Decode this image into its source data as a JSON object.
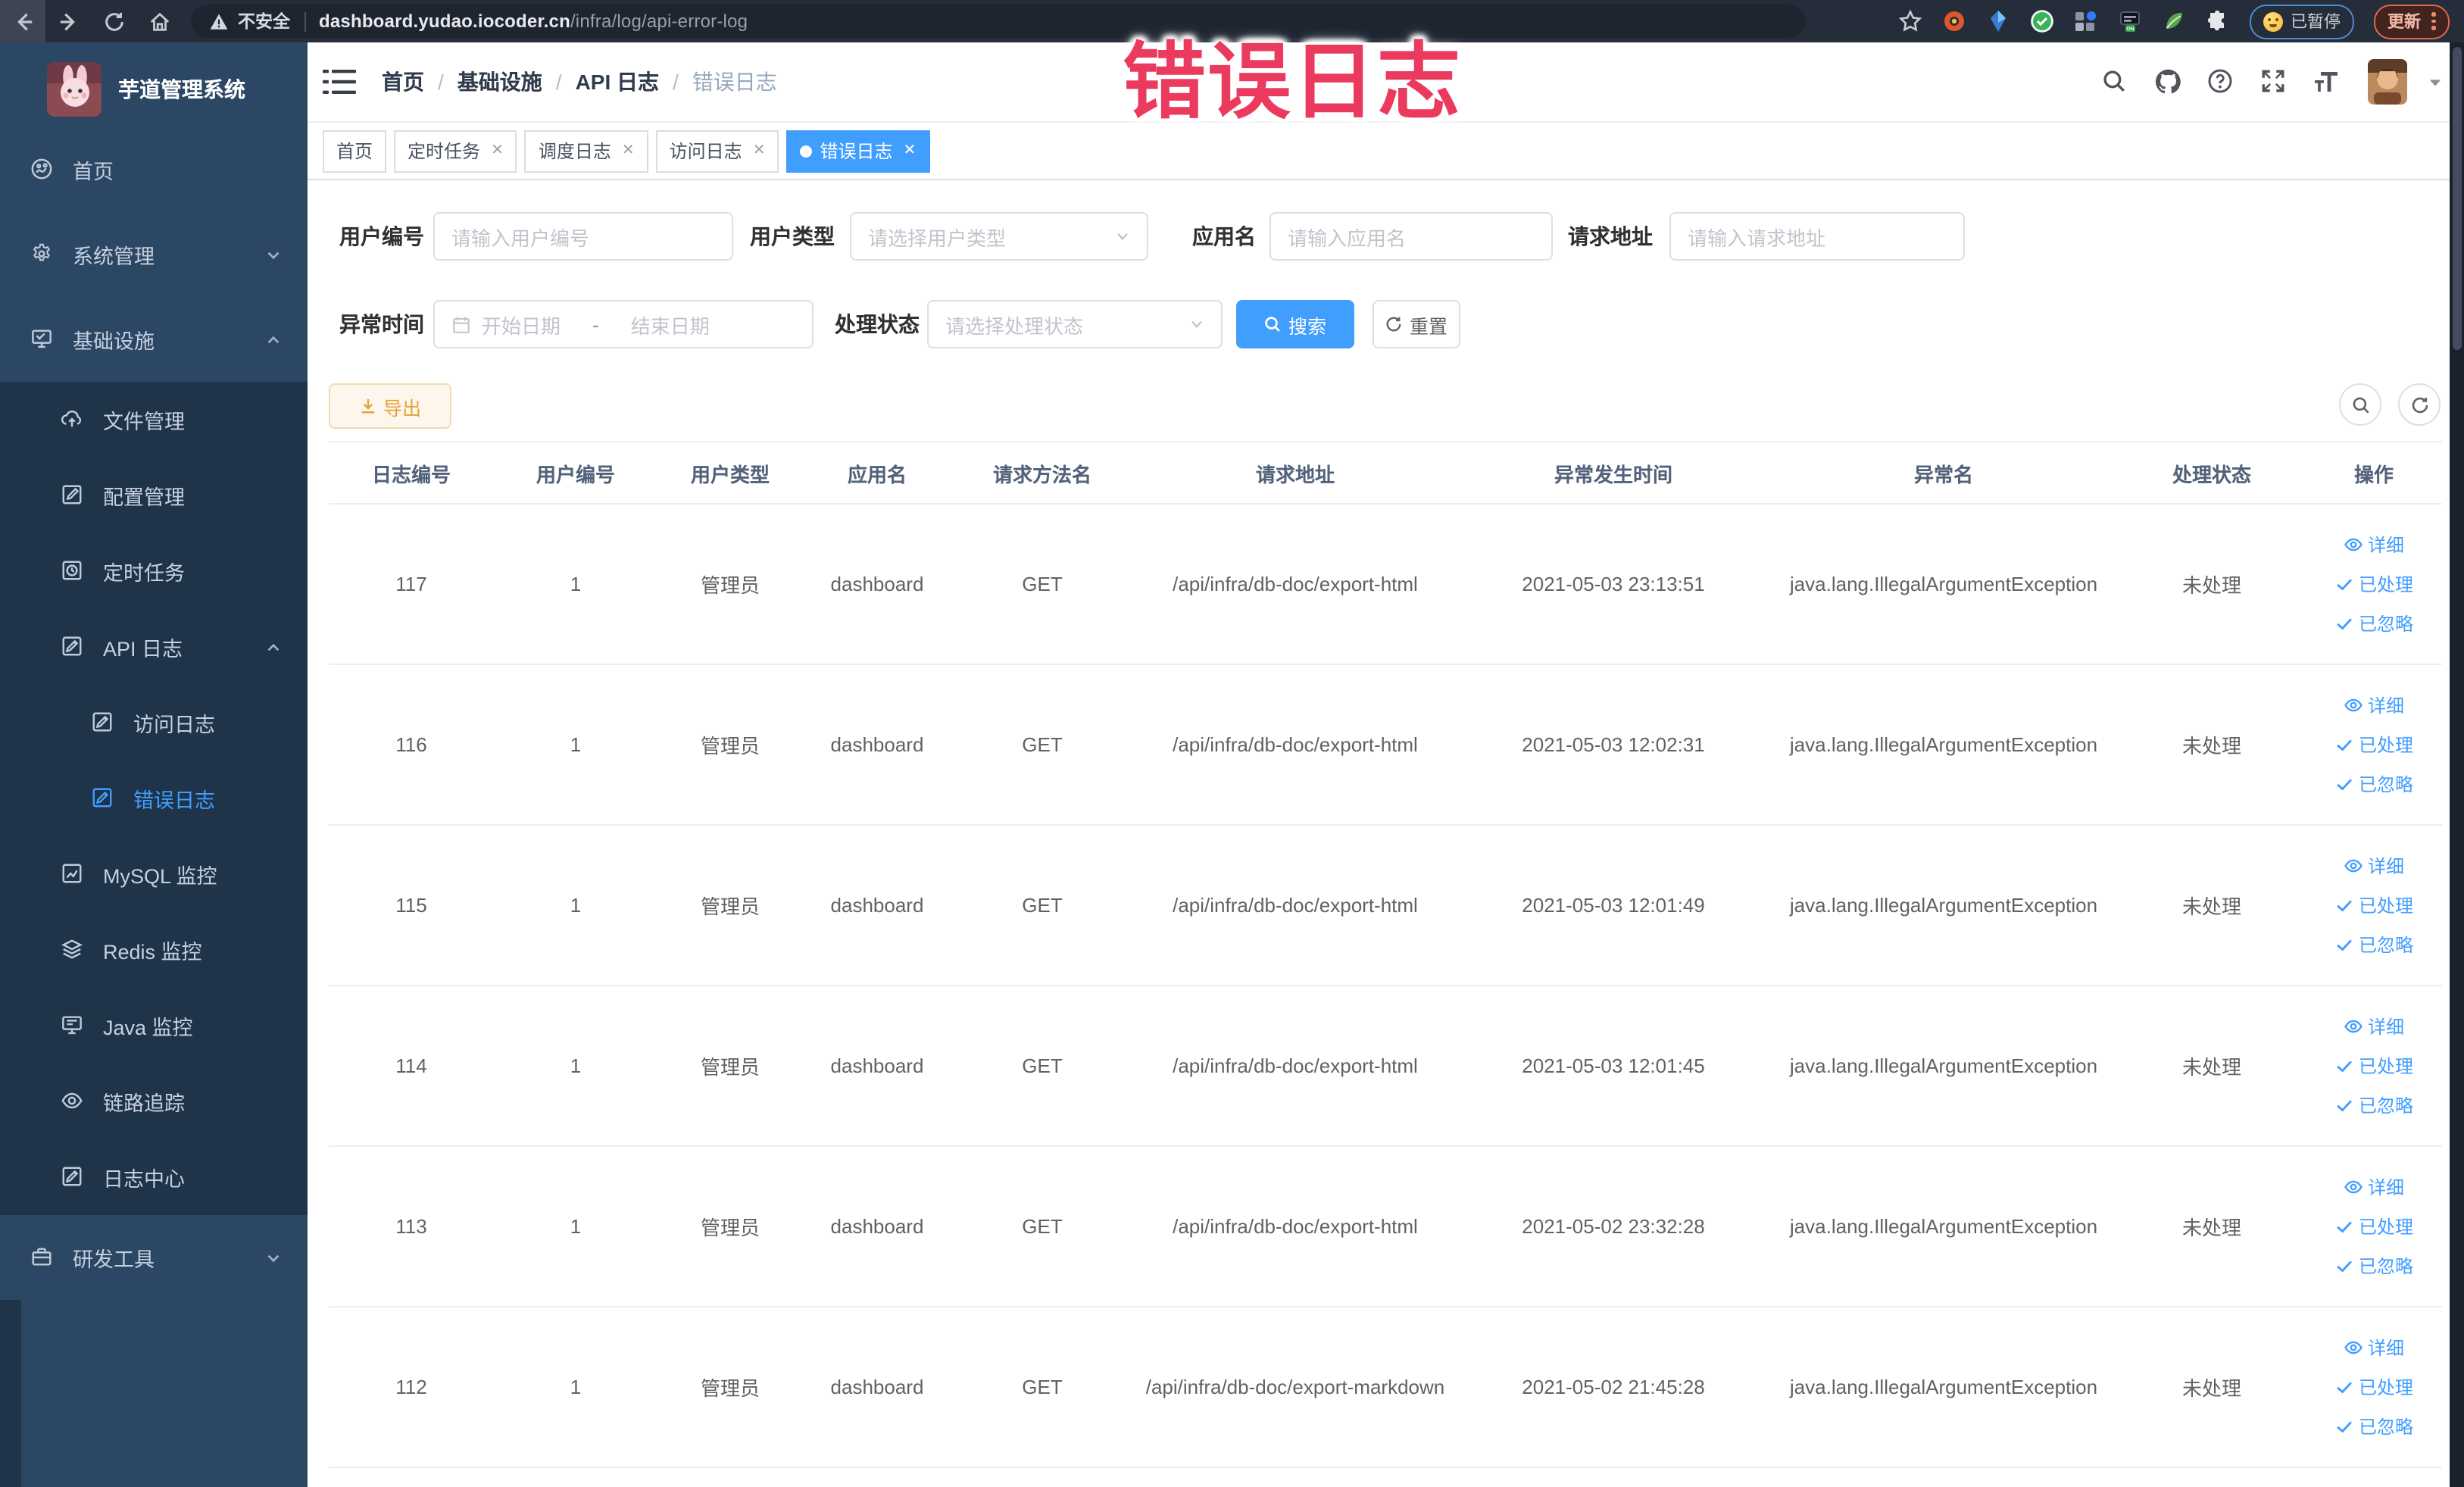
{
  "browser": {
    "security_label": "不安全",
    "url_host": "dashboard.yudao.iocoder.cn",
    "url_path": "/infra/log/api-error-log",
    "paused_label": "已暂停",
    "update_label": "更新",
    "nav_icons": [
      "back-icon",
      "forward-icon",
      "reload-icon",
      "home-icon"
    ],
    "extension_icons": [
      "orange-ring-extension-icon",
      "blue-drop-extension-icon",
      "green-check-extension-icon",
      "grid-extension-icon",
      "switch-on-extension-icon",
      "leaf-extension-icon",
      "puzzle-extensions-icon"
    ]
  },
  "annotation": {
    "text": "错误日志",
    "color": "#ea3b5f"
  },
  "sidebar": {
    "title": "芋道管理系统",
    "items": [
      {
        "label": "首页",
        "icon": "home",
        "level": 0
      },
      {
        "label": "系统管理",
        "icon": "gear",
        "level": 0,
        "chevron": "down"
      },
      {
        "label": "基础设施",
        "icon": "infra",
        "level": 0,
        "chevron": "up"
      },
      {
        "label": "文件管理",
        "icon": "cloud-upload",
        "level": 1,
        "dark": true
      },
      {
        "label": "配置管理",
        "icon": "edit-square",
        "level": 1,
        "dark": true
      },
      {
        "label": "定时任务",
        "icon": "clock",
        "level": 1,
        "dark": true
      },
      {
        "label": "API 日志",
        "icon": "doc-edit",
        "level": 1,
        "dark": true,
        "chevron": "up"
      },
      {
        "label": "访问日志",
        "icon": "doc-edit",
        "level": 2,
        "dark": true
      },
      {
        "label": "错误日志",
        "icon": "doc-edit",
        "level": 2,
        "dark": true,
        "active": true
      },
      {
        "label": "MySQL 监控",
        "icon": "chart",
        "level": 1,
        "dark": true
      },
      {
        "label": "Redis 监控",
        "icon": "layers",
        "level": 1,
        "dark": true
      },
      {
        "label": "Java 监控",
        "icon": "monitor",
        "level": 1,
        "dark": true
      },
      {
        "label": "链路追踪",
        "icon": "eye",
        "level": 1,
        "dark": true
      },
      {
        "label": "日志中心",
        "icon": "doc-edit",
        "level": 1,
        "dark": true
      },
      {
        "label": "研发工具",
        "icon": "toolbox",
        "level": 0,
        "chevron": "down"
      }
    ]
  },
  "header": {
    "breadcrumb": [
      "首页",
      "基础设施",
      "API 日志",
      "错误日志"
    ],
    "right_icons": [
      "search-icon",
      "github-icon",
      "help-icon",
      "fullscreen-icon",
      "font-size-icon"
    ]
  },
  "tabs": [
    {
      "label": "首页",
      "closable": false,
      "active": false
    },
    {
      "label": "定时任务",
      "closable": true,
      "active": false
    },
    {
      "label": "调度日志",
      "closable": true,
      "active": false
    },
    {
      "label": "访问日志",
      "closable": true,
      "active": false
    },
    {
      "label": "错误日志",
      "closable": true,
      "active": true
    }
  ],
  "filters": {
    "user_id_label": "用户编号",
    "user_id_placeholder": "请输入用户编号",
    "user_type_label": "用户类型",
    "user_type_placeholder": "请选择用户类型",
    "app_name_label": "应用名",
    "app_name_placeholder": "请输入应用名",
    "request_url_label": "请求地址",
    "request_url_placeholder": "请输入请求地址",
    "exception_time_label": "异常时间",
    "date_start_placeholder": "开始日期",
    "date_separator": "-",
    "date_end_placeholder": "结束日期",
    "process_status_label": "处理状态",
    "process_status_placeholder": "请选择处理状态",
    "search_label": "搜索",
    "reset_label": "重置"
  },
  "toolbar": {
    "export_label": "导出"
  },
  "table": {
    "headers": [
      "日志编号",
      "用户编号",
      "用户类型",
      "应用名",
      "请求方法名",
      "请求地址",
      "异常发生时间",
      "异常名",
      "处理状态",
      "操作"
    ],
    "action_labels": [
      "详细",
      "已处理",
      "已忽略"
    ],
    "rows": [
      {
        "id": "117",
        "user_id": "1",
        "user_type": "管理员",
        "app": "dashboard",
        "method": "GET",
        "url": "/api/infra/db-doc/export-html",
        "time": "2021-05-03 23:13:51",
        "exception": "java.lang.IllegalArgumentException",
        "status": "未处理"
      },
      {
        "id": "116",
        "user_id": "1",
        "user_type": "管理员",
        "app": "dashboard",
        "method": "GET",
        "url": "/api/infra/db-doc/export-html",
        "time": "2021-05-03 12:02:31",
        "exception": "java.lang.IllegalArgumentException",
        "status": "未处理"
      },
      {
        "id": "115",
        "user_id": "1",
        "user_type": "管理员",
        "app": "dashboard",
        "method": "GET",
        "url": "/api/infra/db-doc/export-html",
        "time": "2021-05-03 12:01:49",
        "exception": "java.lang.IllegalArgumentException",
        "status": "未处理"
      },
      {
        "id": "114",
        "user_id": "1",
        "user_type": "管理员",
        "app": "dashboard",
        "method": "GET",
        "url": "/api/infra/db-doc/export-html",
        "time": "2021-05-03 12:01:45",
        "exception": "java.lang.IllegalArgumentException",
        "status": "未处理"
      },
      {
        "id": "113",
        "user_id": "1",
        "user_type": "管理员",
        "app": "dashboard",
        "method": "GET",
        "url": "/api/infra/db-doc/export-html",
        "time": "2021-05-02 23:32:28",
        "exception": "java.lang.IllegalArgumentException",
        "status": "未处理"
      },
      {
        "id": "112",
        "user_id": "1",
        "user_type": "管理员",
        "app": "dashboard",
        "method": "GET",
        "url": "/api/infra/db-doc/export-markdown",
        "time": "2021-05-02 21:45:28",
        "exception": "java.lang.IllegalArgumentException",
        "status": "未处理"
      }
    ]
  }
}
